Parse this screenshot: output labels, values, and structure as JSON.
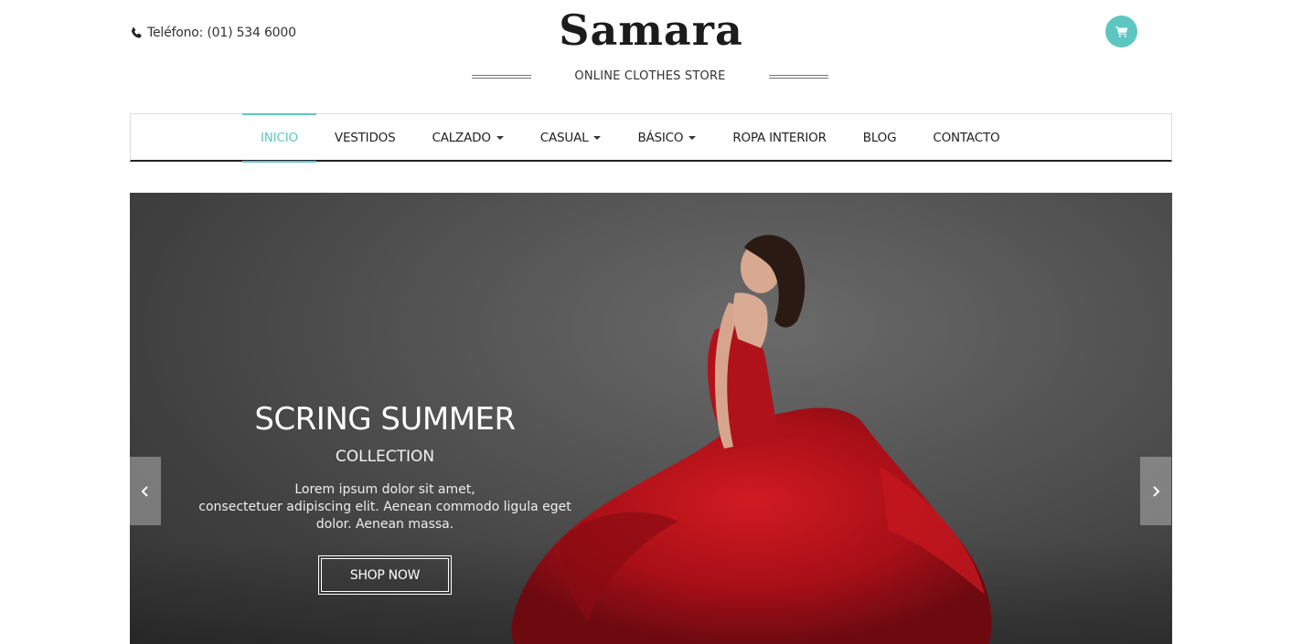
{
  "header": {
    "phone_text": "Teléfono: (01) 534 6000",
    "logo": "Samara",
    "tagline": "ONLINE CLOTHES STORE",
    "cart_icon": "shopping-cart-icon"
  },
  "nav": {
    "items": [
      {
        "label": "INICIO",
        "active": true,
        "dropdown": false
      },
      {
        "label": "VESTIDOS",
        "active": false,
        "dropdown": false
      },
      {
        "label": "CALZADO",
        "active": false,
        "dropdown": true
      },
      {
        "label": "CASUAL",
        "active": false,
        "dropdown": true
      },
      {
        "label": "BÁSICO",
        "active": false,
        "dropdown": true
      },
      {
        "label": "ROPA INTERIOR",
        "active": false,
        "dropdown": false
      },
      {
        "label": "BLOG",
        "active": false,
        "dropdown": false
      },
      {
        "label": "CONTACTO",
        "active": false,
        "dropdown": false
      }
    ]
  },
  "hero": {
    "title": "SCRING SUMMER",
    "subtitle": "COLLECTION",
    "text_line1": "Lorem ipsum dolor sit amet,",
    "text_line2": "consectetuer adipiscing elit. Aenean commodo ligula eget",
    "text_line3": "dolor. Aenean massa.",
    "button_label": "SHOP NOW",
    "prev_icon": "chevron-left-icon",
    "next_icon": "chevron-right-icon"
  },
  "colors": {
    "accent": "#5ec6c0",
    "dress": "#b5121b",
    "hero_bg": "#4a4a4a"
  }
}
